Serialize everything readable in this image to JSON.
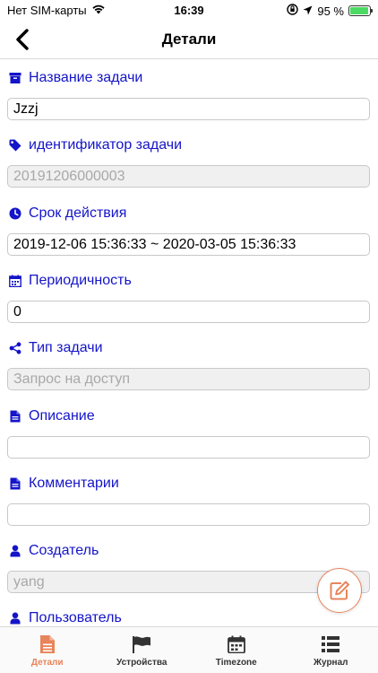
{
  "status_bar": {
    "carrier": "Нет SIM-карты",
    "time": "16:39",
    "battery": "95 %",
    "battery_level": 0.95
  },
  "header": {
    "title": "Детали"
  },
  "fields": [
    {
      "label": "Название задачи",
      "value": "Jzzj",
      "placeholder": "",
      "disabled": false,
      "icon": "archive-icon"
    },
    {
      "label": "идентификатор задачи",
      "value": "",
      "placeholder": "20191206000003",
      "disabled": true,
      "icon": "tag-icon"
    },
    {
      "label": "Срок действия",
      "value": "2019-12-06 15:36:33 ~ 2020-03-05 15:36:33",
      "placeholder": "",
      "disabled": false,
      "icon": "clock-icon"
    },
    {
      "label": "Периодичность",
      "value": "0",
      "placeholder": "",
      "disabled": false,
      "icon": "calendar-icon"
    },
    {
      "label": "Тип задачи",
      "value": "",
      "placeholder": "Запрос на доступ",
      "disabled": true,
      "icon": "share-icon"
    },
    {
      "label": "Описание",
      "value": "",
      "placeholder": "",
      "disabled": false,
      "icon": "document-icon"
    },
    {
      "label": "Комментарии",
      "value": "",
      "placeholder": "",
      "disabled": false,
      "icon": "document-icon"
    },
    {
      "label": "Создатель",
      "value": "",
      "placeholder": "yang",
      "disabled": true,
      "icon": "user-icon"
    },
    {
      "label": "Пользователь",
      "value": "",
      "placeholder": "",
      "disabled": false,
      "icon": "user-icon"
    }
  ],
  "tabs": [
    {
      "label": "Детали",
      "icon": "document-icon",
      "active": true
    },
    {
      "label": "Устройства",
      "icon": "flag-icon",
      "active": false
    },
    {
      "label": "Timezone",
      "icon": "calendar-icon",
      "active": false
    },
    {
      "label": "Журнал",
      "icon": "list-icon",
      "active": false
    }
  ],
  "colors": {
    "label_blue": "#1414c8",
    "accent_orange": "#e8845b",
    "battery_green": "#4cd964"
  }
}
